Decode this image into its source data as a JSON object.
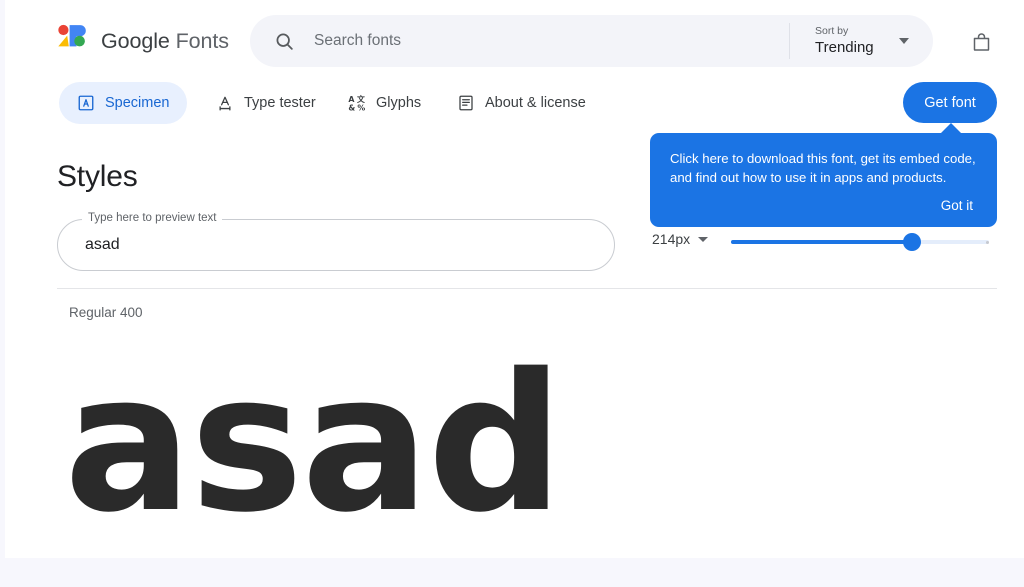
{
  "header": {
    "brand_strong": "Google",
    "brand_light": "Fonts",
    "logo_icon": "google-fonts-logo-icon",
    "search": {
      "icon": "search-icon",
      "placeholder": "Search fonts",
      "value": ""
    },
    "sort": {
      "label": "Sort by",
      "value": "Trending",
      "caret_icon": "chevron-down-icon"
    },
    "bag_icon": "shopping-bag-icon"
  },
  "tabs": [
    {
      "id": "specimen",
      "label": "Specimen",
      "icon": "specimen-letter-a-icon",
      "active": true
    },
    {
      "id": "typetester",
      "label": "Type tester",
      "icon": "type-tester-icon",
      "active": false
    },
    {
      "id": "glyphs",
      "label": "Glyphs",
      "icon": "glyphs-icon",
      "active": false
    },
    {
      "id": "about",
      "label": "About & license",
      "icon": "about-license-icon",
      "active": false
    }
  ],
  "get_font": {
    "label": "Get font"
  },
  "tooltip": {
    "text": "Click here to download this font, get its embed code, and find out how to use it in apps and products.",
    "dismiss_label": "Got it",
    "background_color": "#1b74e4"
  },
  "main": {
    "section_title": "Styles",
    "preview": {
      "legend": "Type here to preview text",
      "value": "asad",
      "placeholder": "Type here to preview text"
    },
    "size": {
      "value": "214px",
      "caret_icon": "chevron-down-icon",
      "slider_percent": 70,
      "accent_color": "#1b74e4",
      "track_color": "#e4edfb"
    },
    "style_row": {
      "weight_label": "Regular 400",
      "sample_text": "asad"
    }
  }
}
